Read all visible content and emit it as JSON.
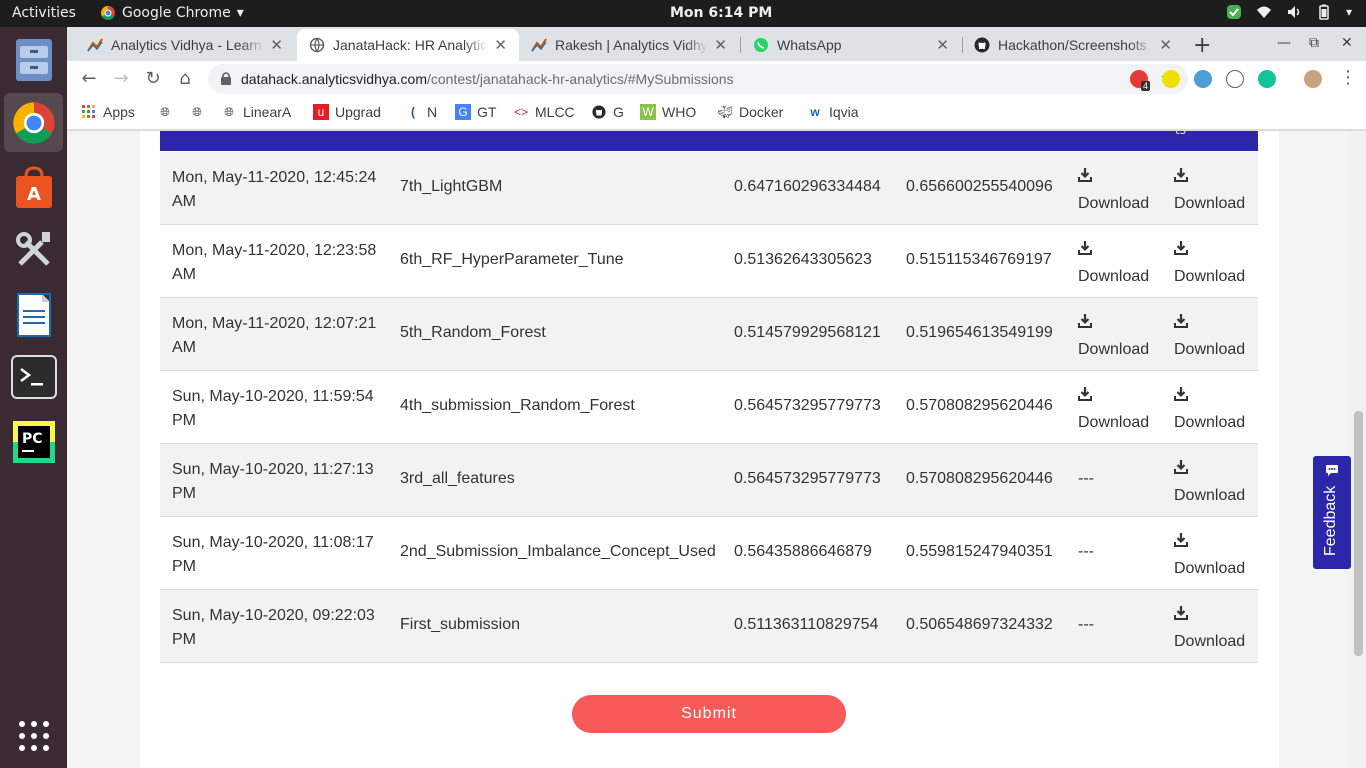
{
  "topbar": {
    "activities": "Activities",
    "app_name": "Google Chrome",
    "clock": "Mon  6:14 PM"
  },
  "dock": {
    "items": [
      "files-icon",
      "chrome-icon",
      "software-center-icon",
      "settings-icon",
      "writer-icon",
      "terminal-icon",
      "pycharm-icon",
      "app-grid-icon"
    ]
  },
  "browser": {
    "tabs": [
      {
        "title": "Analytics Vidhya - Learn",
        "icon": "analytics-vidhya-icon",
        "active": false
      },
      {
        "title": "JanataHack: HR Analytics",
        "icon": "globe-icon",
        "active": true
      },
      {
        "title": "Rakesh | Analytics Vidhya",
        "icon": "analytics-vidhya-icon",
        "active": false
      },
      {
        "title": "WhatsApp",
        "icon": "whatsapp-icon",
        "active": false
      },
      {
        "title": "Hackathon/Screenshots",
        "icon": "github-icon",
        "active": false
      }
    ],
    "url_host": "datahack.analyticsvidhya.com",
    "url_path": "/contest/janatahack-hr-analytics/#MySubmissions",
    "extension_badge": "4"
  },
  "bookmarks": [
    {
      "label": "Apps",
      "icon": "apps-grid-icon"
    },
    {
      "label": "",
      "icon": "globe-icon"
    },
    {
      "label": "",
      "icon": "globe-icon"
    },
    {
      "label": "LinearA",
      "icon": "globe-icon"
    },
    {
      "label": "Upgrad",
      "icon": "upgrad-icon"
    },
    {
      "label": "N",
      "icon": "n-icon"
    },
    {
      "label": "GT",
      "icon": "translate-icon"
    },
    {
      "label": "MLCC",
      "icon": "mlcc-icon"
    },
    {
      "label": "G",
      "icon": "github-icon"
    },
    {
      "label": "WHO",
      "icon": "who-icon"
    },
    {
      "label": "Docker",
      "icon": "docker-icon"
    },
    {
      "label": "Iqvia",
      "icon": "iqvia-icon"
    }
  ],
  "submissions": {
    "header_partial": "ts",
    "download_label": "Download",
    "rows": [
      {
        "date": "Mon, May-11-2020, 12:45:24 AM",
        "name": "7th_LightGBM",
        "public": "0.647160296334484",
        "private": "0.656600255540096",
        "file1": "Download",
        "file2": "Download"
      },
      {
        "date": "Mon, May-11-2020, 12:23:58 AM",
        "name": "6th_RF_HyperParameter_Tune",
        "public": "0.51362643305623",
        "private": "0.515115346769197",
        "file1": "Download",
        "file2": "Download"
      },
      {
        "date": "Mon, May-11-2020, 12:07:21 AM",
        "name": "5th_Random_Forest",
        "public": "0.514579929568121",
        "private": "0.519654613549199",
        "file1": "Download",
        "file2": "Download"
      },
      {
        "date": "Sun, May-10-2020, 11:59:54 PM",
        "name": "4th_submission_Random_Forest",
        "public": "0.564573295779773",
        "private": "0.570808295620446",
        "file1": "Download",
        "file2": "Download"
      },
      {
        "date": "Sun, May-10-2020, 11:27:13 PM",
        "name": "3rd_all_features",
        "public": "0.564573295779773",
        "private": "0.570808295620446",
        "file1": "---",
        "file2": "Download"
      },
      {
        "date": "Sun, May-10-2020, 11:08:17 PM",
        "name": "2nd_Submission_Imbalance_Concept_Used",
        "public": "0.56435886646879",
        "private": "0.559815247940351",
        "file1": "---",
        "file2": "Download"
      },
      {
        "date": "Sun, May-10-2020, 09:22:03 PM",
        "name": "First_submission",
        "public": "0.511363110829754",
        "private": "0.506548697324332",
        "file1": "---",
        "file2": "Download"
      }
    ]
  },
  "submit_label": "Submit",
  "feedback_label": "Feedback",
  "colors": {
    "header_blue": "#2b27a8",
    "submit_red": "#f85959",
    "row_alt": "#f2f2f2"
  }
}
